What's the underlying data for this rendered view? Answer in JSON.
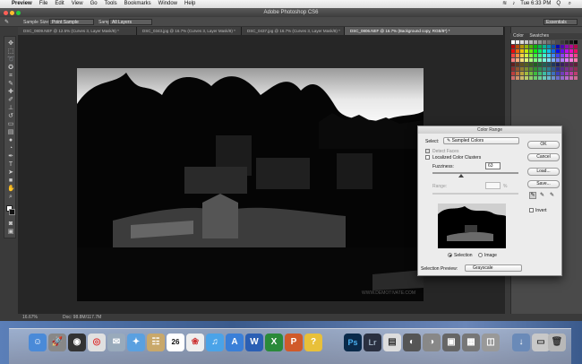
{
  "menubar": {
    "apple": "",
    "app": "Preview",
    "items": [
      "File",
      "Edit",
      "View",
      "Go",
      "Tools",
      "Bookmarks",
      "Window",
      "Help"
    ],
    "clock": "Tue 6:33 PM",
    "user": "Q"
  },
  "title": "Adobe Photoshop CS6",
  "options": {
    "sample_size_label": "Sample Size:",
    "sample_size_value": "Point Sample",
    "sample_label": "Sample:",
    "sample_value": "All Layers",
    "workspace": "Essentials"
  },
  "tabs": [
    {
      "label": "DSC_0809.NEF @ 12.5% (Curves 3, Layer Mask/8) *"
    },
    {
      "label": "DSC_0343.jpg @ 16.7% (Curves 3, Layer Mask/8) *"
    },
    {
      "label": "DSC_0437.jpg @ 16.7% (Curves 3, Layer Mask/8) *"
    },
    {
      "label": "DSC_0806.NEF @ 16.7% (Background copy, RGB/8*) *"
    }
  ],
  "status": {
    "zoom": "16.67%",
    "doc": "Doc: 98.8M/117.7M"
  },
  "watermark": "WWW.DEMOTIVATE.COM",
  "panels": {
    "tab_color": "Color",
    "tab_swatches": "Swatches"
  },
  "dialog": {
    "title": "Color Range",
    "select_label": "Select:",
    "select_value": "Sampled Colors",
    "detect_faces": "Detect Faces",
    "localized": "Localized Color Clusters",
    "fuzziness_label": "Fuzziness:",
    "fuzziness_value": "63",
    "range_label": "Range:",
    "range_unit": "%",
    "ok": "OK",
    "cancel": "Cancel",
    "load": "Load...",
    "save": "Save...",
    "invert": "Invert",
    "radio_selection": "Selection",
    "radio_image": "Image",
    "selection_preview_label": "Selection Preview:",
    "selection_preview_value": "Grayscale"
  },
  "dock": {
    "calendar_day": "26",
    "ps": "Ps",
    "lr": "Lr"
  }
}
